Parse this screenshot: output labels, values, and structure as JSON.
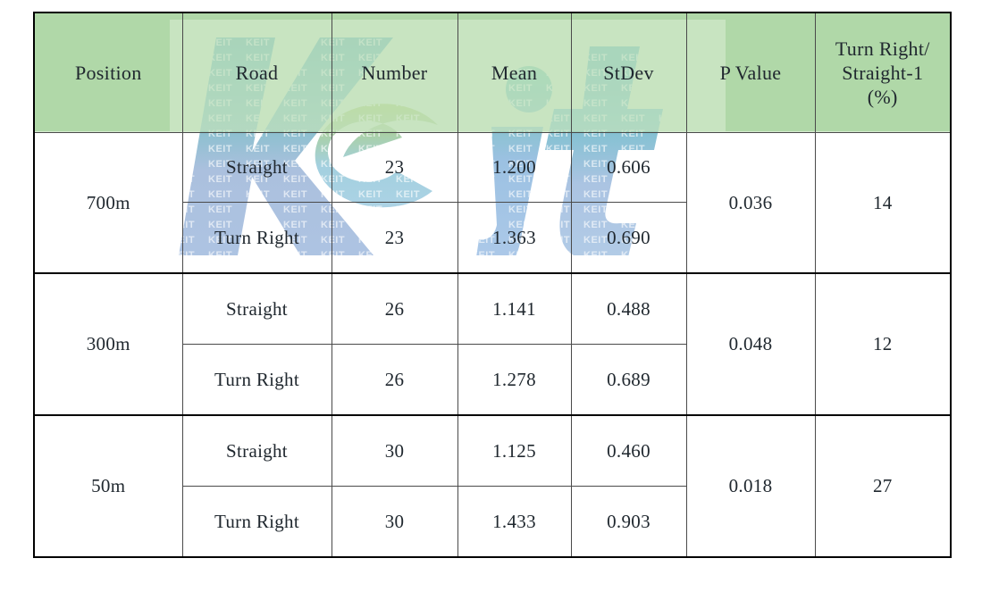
{
  "figure": {
    "kind": "statistics-table",
    "watermark": {
      "text": "Keit",
      "micro_text": "KEIT",
      "colors": {
        "teal": "#4aa5a8",
        "blue": "#9cb8dd",
        "light_blue": "#a9cfe8",
        "green": "#8cc152",
        "yellow_green": "#a8c84a"
      }
    },
    "colors": {
      "header_green": "#b0d8a8",
      "header_green_light": "#cbe5c2",
      "text": "#20282f",
      "border": "#000000",
      "inner_border": "#4a4a4a"
    }
  },
  "table": {
    "columns": [
      {
        "key": "position",
        "label": "Position"
      },
      {
        "key": "road",
        "label": "Road"
      },
      {
        "key": "number",
        "label": "Number"
      },
      {
        "key": "mean",
        "label": "Mean"
      },
      {
        "key": "stdev",
        "label": "StDev"
      },
      {
        "key": "p_value",
        "label": "P Value"
      },
      {
        "key": "ratio",
        "label": "Turn Right/\nStraight-1\n(%)"
      }
    ],
    "column_labels_flat": [
      "Position",
      "Road",
      "Number",
      "Mean",
      "StDev",
      "P Value",
      "Turn Right/ Straight-1 (%)"
    ],
    "ratio_header_lines": [
      "Turn Right/",
      "Straight-1",
      "(%)"
    ],
    "groups": [
      {
        "position": "700m",
        "p_value": "0.036",
        "ratio": "14",
        "rows": [
          {
            "road": "Straight",
            "number": "23",
            "mean": "1.200",
            "stdev": "0.606"
          },
          {
            "road": "Turn Right",
            "number": "23",
            "mean": "1.363",
            "stdev": "0.690"
          }
        ]
      },
      {
        "position": "300m",
        "p_value": "0.048",
        "ratio": "12",
        "rows": [
          {
            "road": "Straight",
            "number": "26",
            "mean": "1.141",
            "stdev": "0.488"
          },
          {
            "road": "Turn Right",
            "number": "26",
            "mean": "1.278",
            "stdev": "0.689"
          }
        ]
      },
      {
        "position": "50m",
        "p_value": "0.018",
        "ratio": "27",
        "rows": [
          {
            "road": "Straight",
            "number": "30",
            "mean": "1.125",
            "stdev": "0.460"
          },
          {
            "road": "Turn Right",
            "number": "30",
            "mean": "1.433",
            "stdev": "0.903"
          }
        ]
      }
    ]
  },
  "chart_data": {
    "type": "table",
    "title": "",
    "columns": [
      "Position",
      "Road",
      "Number",
      "Mean",
      "StDev",
      "P Value",
      "Turn Right/Straight-1 (%)"
    ],
    "rows": [
      [
        "700m",
        "Straight",
        23,
        1.2,
        0.606,
        0.036,
        14
      ],
      [
        "700m",
        "Turn Right",
        23,
        1.363,
        0.69,
        0.036,
        14
      ],
      [
        "300m",
        "Straight",
        26,
        1.141,
        0.488,
        0.048,
        12
      ],
      [
        "300m",
        "Turn Right",
        26,
        1.278,
        0.689,
        0.048,
        12
      ],
      [
        "50m",
        "Straight",
        30,
        1.125,
        0.46,
        0.018,
        27
      ],
      [
        "50m",
        "Turn Right",
        30,
        1.433,
        0.903,
        0.018,
        27
      ]
    ]
  }
}
